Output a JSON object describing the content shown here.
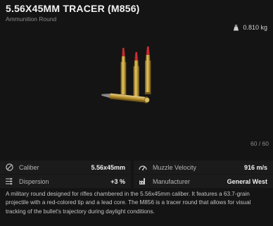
{
  "item": {
    "title": "5.56X45MM TRACER (M856)",
    "subtitle": "Ammunition Round",
    "weight": "0.810 kg",
    "weight_icon": "weight-icon",
    "capacity": "60 / 60"
  },
  "stats": [
    {
      "label": "Caliber",
      "value": "5.56x45mm",
      "icon": "caliber-icon"
    },
    {
      "label": "Muzzle Velocity",
      "value": "916 m/s",
      "icon": "speedometer-icon"
    },
    {
      "label": "Dispersion",
      "value": "+3 %",
      "icon": "dispersion-icon"
    },
    {
      "label": "Manufacturer",
      "value": "General West",
      "icon": "factory-icon"
    }
  ],
  "description": "A military round designed for rifles chambered in the 5.56x45mm caliber. It features a 63.7-grain projectile with a red-colored tip and a lead core. The M856 is a tracer round that allows for visual tracking of the bullet's trajectory during daylight conditions.",
  "colors": {
    "background": "#141414",
    "panel": "#1b1b1b",
    "tip_red": "#c0262b",
    "brass": "#c9a645"
  }
}
